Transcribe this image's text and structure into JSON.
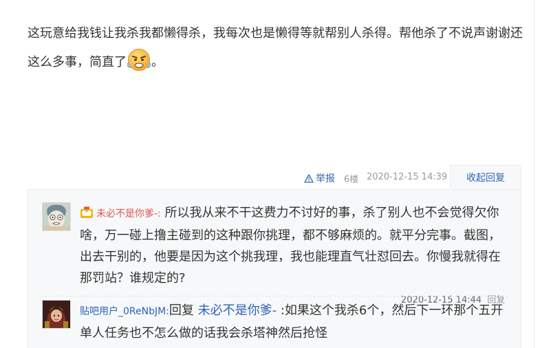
{
  "post": {
    "line1": "这玩意给我钱让我杀我都懒得杀，我每次也是懒得等就帮别人杀得。帮他杀了不说声谢谢还",
    "line2_prefix": "这么多事，简直了",
    "line2_suffix": "。",
    "emoji_icon": "angry-emoji-icon"
  },
  "post_tail": {
    "report_label": "举报",
    "floor": "6楼",
    "datetime": "2020-12-15 14:39",
    "collapse_label": "收起回复"
  },
  "replies": [
    {
      "username": "未必不是你爹-:",
      "username_color": "#e1574f",
      "badge_icon": "vip-crown-icon",
      "text": " 所以我从来不干这费力不讨好的事，杀了别人也不会觉得欠你啥，万一碰上撸主碰到的这种跟你挑理，都不够麻烦的。就平分完事。截图，出去干别的，他要是因为这个挑我理，我也能理直气壮怼回去。你慢我就得在那罚站？谁规定的?",
      "datetime": "2020-12-15 14:44",
      "reply_label": "回复"
    },
    {
      "username": "贴吧用户_0ReNbJM:",
      "reply_prefix": "回复 ",
      "reply_to": "未必不是你爹-",
      "text": " :如果这个我杀6个，然后下一环那个五开单人任务也不怎么做的话我会杀塔神然后抢怪"
    }
  ],
  "colors": {
    "link_blue": "#2d64b3",
    "username_red": "#e1574f",
    "reply_bg": "#f7f8fa",
    "meta_gray": "#999999"
  }
}
